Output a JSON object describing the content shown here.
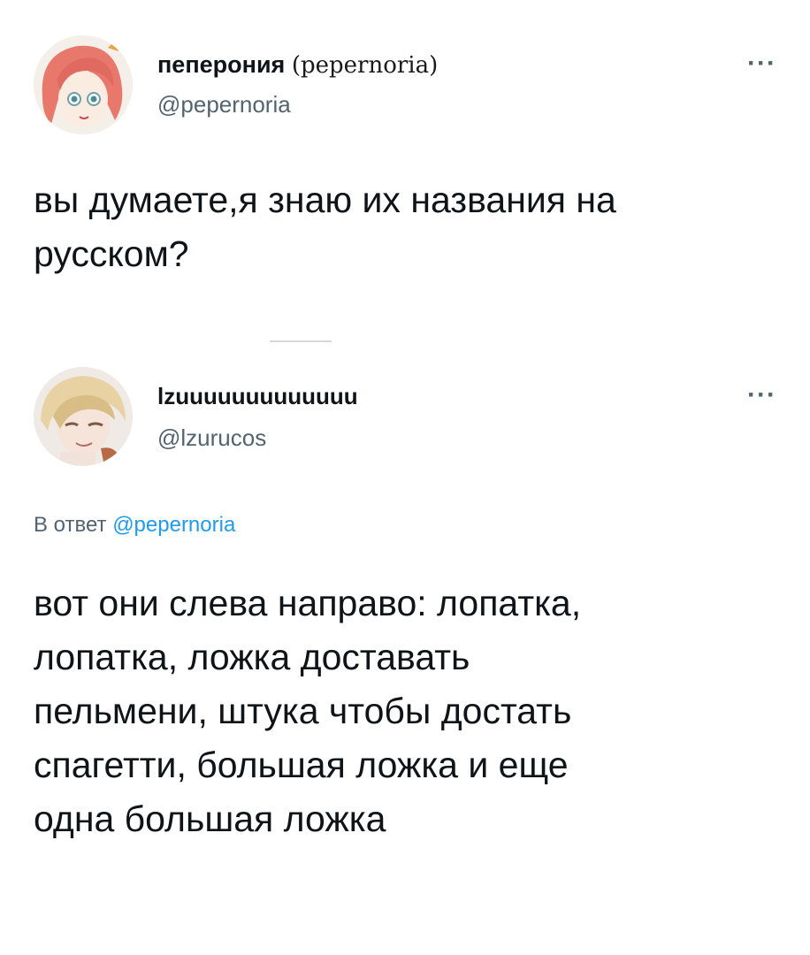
{
  "tweet1": {
    "display_name": "пеперония",
    "display_name_suffix": "(pepernoria)",
    "handle": "@pepernoria",
    "more_label": "···",
    "text": "вы думаете,я знаю их названия на русском?"
  },
  "tweet2": {
    "display_name": "lzuuuuuuuuuuuuu",
    "handle": "@lzurucos",
    "more_label": "···",
    "reply_prefix": "В ответ",
    "reply_mention": "@pepernoria",
    "text": "вот они слева направо: лопатка, лопатка, ложка доставать пельмени, штука чтобы достать спагетти, большая ложка и еще одна большая ложка"
  },
  "colors": {
    "text": "#0f1419",
    "secondary": "#536471",
    "mention": "#1d9bf0"
  },
  "icons": {
    "avatar1": "anime-girl-avatar",
    "avatar2": "anime-boy-avatar",
    "more": "more-options-icon"
  }
}
